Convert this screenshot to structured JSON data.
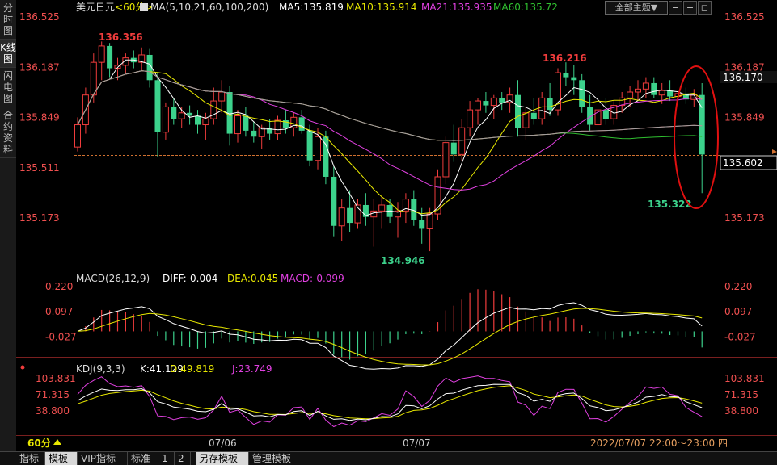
{
  "sidebar": {
    "tabs": [
      {
        "label": "分时图",
        "active": false
      },
      {
        "label": "K线图",
        "active": true
      },
      {
        "label": "闪电图",
        "active": false
      },
      {
        "label": "合约资料",
        "active": false
      }
    ]
  },
  "header": {
    "symbol": "美元日元",
    "period": "<60分>",
    "ma_params": "MA(5,10,21,60,100,200)",
    "ma5": "MA5:135.819",
    "ma10": "MA10:135.914",
    "ma21": "MA21:135.935",
    "ma60": "MA60:135.72",
    "theme_select": "全部主题▼",
    "colors": {
      "ma5": "#ffffff",
      "ma10": "#e8e800",
      "ma21": "#e040e0",
      "ma60": "#30c030",
      "up": "#f03c3c",
      "down": "#3cd28c"
    }
  },
  "main_axis": {
    "left_ticks": [
      "136.525",
      "136.187",
      "135.849",
      "135.511",
      "135.173"
    ],
    "right_ticks": [
      "136.525",
      "136.187",
      "135.849",
      "135.173"
    ],
    "current_price": "135.602",
    "right_value_box": "136.170",
    "annotations": {
      "high1": "136.356",
      "high2": "136.216",
      "low1": "134.946",
      "low2": "135.322"
    }
  },
  "macd": {
    "title": "MACD(26,12,9)",
    "diff": "DIFF:-0.004",
    "dea": "DEA:0.045",
    "macd": "MACD:-0.099",
    "ticks": [
      "0.220",
      "0.097",
      "-0.027"
    ]
  },
  "kdj": {
    "title": "KDJ(9,3,3)",
    "k": "K:41.129",
    "d": "D:49.819",
    "j": "J:23.749",
    "ticks": [
      "103.831",
      "71.315",
      "38.800"
    ]
  },
  "xaxis": {
    "period_label": "60分",
    "dates": [
      "07/06",
      "07/07"
    ],
    "range": "2022/07/07 22:00～23:00 四"
  },
  "bottom_tabs": [
    "指标",
    "模板",
    "VIP指标",
    "标准",
    "1",
    "2",
    "另存模板",
    "管理模板"
  ],
  "chart_data": {
    "type": "candlestick",
    "period": "60min",
    "ohlc": [
      [
        135.65,
        135.85,
        135.62,
        135.8
      ],
      [
        135.8,
        136.05,
        135.74,
        136.0
      ],
      [
        136.0,
        136.28,
        135.95,
        136.22
      ],
      [
        136.22,
        136.36,
        136.1,
        136.33
      ],
      [
        136.33,
        136.35,
        136.12,
        136.18
      ],
      [
        136.18,
        136.25,
        136.1,
        136.2
      ],
      [
        136.2,
        136.28,
        136.14,
        136.25
      ],
      [
        136.25,
        136.3,
        136.18,
        136.22
      ],
      [
        136.22,
        136.32,
        136.16,
        136.27
      ],
      [
        136.27,
        136.31,
        136.05,
        136.1
      ],
      [
        136.1,
        136.15,
        135.58,
        135.75
      ],
      [
        135.75,
        135.95,
        135.7,
        135.92
      ],
      [
        135.92,
        135.98,
        135.8,
        135.84
      ],
      [
        135.84,
        135.92,
        135.78,
        135.88
      ],
      [
        135.88,
        135.93,
        135.8,
        135.86
      ],
      [
        135.86,
        135.9,
        135.74,
        135.8
      ],
      [
        135.8,
        135.88,
        135.7,
        135.84
      ],
      [
        135.84,
        136.05,
        135.8,
        135.96
      ],
      [
        135.96,
        136.1,
        135.88,
        136.02
      ],
      [
        136.02,
        136.06,
        135.66,
        135.74
      ],
      [
        135.74,
        135.9,
        135.68,
        135.86
      ],
      [
        135.86,
        135.92,
        135.72,
        135.76
      ],
      [
        135.76,
        135.82,
        135.68,
        135.72
      ],
      [
        135.72,
        135.8,
        135.64,
        135.78
      ],
      [
        135.78,
        135.84,
        135.7,
        135.74
      ],
      [
        135.74,
        135.86,
        135.7,
        135.83
      ],
      [
        135.83,
        135.9,
        135.74,
        135.78
      ],
      [
        135.78,
        135.88,
        135.72,
        135.85
      ],
      [
        135.85,
        135.9,
        135.74,
        135.76
      ],
      [
        135.76,
        135.8,
        135.52,
        135.56
      ],
      [
        135.56,
        135.78,
        135.5,
        135.72
      ],
      [
        135.72,
        135.76,
        135.4,
        135.45
      ],
      [
        135.45,
        135.52,
        135.05,
        135.12
      ],
      [
        135.12,
        135.3,
        135.02,
        135.24
      ],
      [
        135.24,
        135.36,
        135.08,
        135.14
      ],
      [
        135.14,
        135.3,
        135.1,
        135.26
      ],
      [
        135.26,
        135.34,
        135.12,
        135.18
      ],
      [
        135.18,
        135.3,
        134.98,
        135.22
      ],
      [
        135.22,
        135.32,
        135.1,
        135.26
      ],
      [
        135.26,
        135.3,
        135.14,
        135.18
      ],
      [
        135.18,
        135.28,
        135.04,
        135.22
      ],
      [
        135.22,
        135.34,
        135.14,
        135.3
      ],
      [
        135.3,
        135.36,
        135.12,
        135.16
      ],
      [
        135.16,
        135.24,
        135.0,
        135.1
      ],
      [
        135.1,
        135.24,
        134.95,
        135.2
      ],
      [
        135.2,
        135.5,
        135.16,
        135.45
      ],
      [
        135.45,
        135.72,
        135.4,
        135.68
      ],
      [
        135.68,
        135.8,
        135.55,
        135.6
      ],
      [
        135.6,
        135.84,
        135.56,
        135.78
      ],
      [
        135.78,
        135.96,
        135.72,
        135.9
      ],
      [
        135.9,
        135.98,
        135.8,
        135.96
      ],
      [
        135.96,
        136.02,
        135.88,
        135.93
      ],
      [
        135.93,
        136.0,
        135.84,
        135.98
      ],
      [
        135.98,
        136.02,
        135.9,
        135.95
      ],
      [
        135.95,
        136.05,
        135.88,
        136.0
      ],
      [
        136.0,
        136.1,
        135.72,
        135.78
      ],
      [
        135.78,
        135.92,
        135.7,
        135.88
      ],
      [
        135.88,
        135.98,
        135.8,
        135.84
      ],
      [
        135.84,
        136.02,
        135.8,
        135.98
      ],
      [
        135.98,
        136.08,
        135.86,
        135.9
      ],
      [
        135.9,
        136.18,
        135.86,
        136.15
      ],
      [
        136.15,
        136.22,
        136.06,
        136.12
      ],
      [
        136.12,
        136.2,
        136.0,
        136.1
      ],
      [
        136.1,
        136.14,
        135.88,
        135.92
      ],
      [
        135.92,
        136.0,
        135.76,
        135.8
      ],
      [
        135.8,
        135.96,
        135.7,
        135.9
      ],
      [
        135.9,
        135.98,
        135.8,
        135.84
      ],
      [
        135.84,
        135.96,
        135.8,
        135.93
      ],
      [
        135.93,
        136.02,
        135.88,
        135.98
      ],
      [
        135.98,
        136.06,
        135.92,
        136.02
      ],
      [
        136.02,
        136.1,
        135.96,
        136.04
      ],
      [
        136.04,
        136.12,
        135.98,
        136.08
      ],
      [
        136.08,
        136.12,
        135.98,
        136.0
      ],
      [
        136.0,
        136.08,
        135.94,
        136.03
      ],
      [
        136.03,
        136.1,
        135.96,
        135.99
      ],
      [
        135.99,
        136.06,
        135.92,
        136.01
      ],
      [
        136.01,
        136.05,
        135.94,
        135.97
      ],
      [
        135.97,
        136.04,
        135.92,
        136.0
      ],
      [
        136.0,
        136.08,
        135.34,
        135.6
      ]
    ]
  }
}
